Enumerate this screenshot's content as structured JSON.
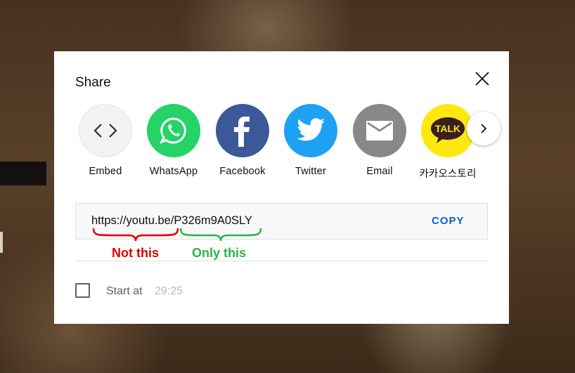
{
  "dialog": {
    "title": "Share"
  },
  "share_targets": [
    {
      "label": "Embed",
      "icon": "embed-icon",
      "color": "#f2f2f2"
    },
    {
      "label": "WhatsApp",
      "icon": "whatsapp-icon",
      "color": "#25d366"
    },
    {
      "label": "Facebook",
      "icon": "facebook-icon",
      "color": "#3b5998"
    },
    {
      "label": "Twitter",
      "icon": "twitter-icon",
      "color": "#1da1f2"
    },
    {
      "label": "Email",
      "icon": "email-icon",
      "color": "#888888"
    },
    {
      "label": "카카오스토리",
      "icon": "kakaotalk-icon",
      "color": "#ffe812",
      "badge": "TALK"
    }
  ],
  "url": {
    "value": "https://youtu.be/P326m9A0SLY",
    "copy_label": "COPY"
  },
  "annotations": {
    "prefix_note": "Not this",
    "id_note": "Only this",
    "prefix_color": "#e00000",
    "id_color": "#2db34a"
  },
  "start_at": {
    "label": "Start at",
    "time": "29:25",
    "checked": false
  }
}
